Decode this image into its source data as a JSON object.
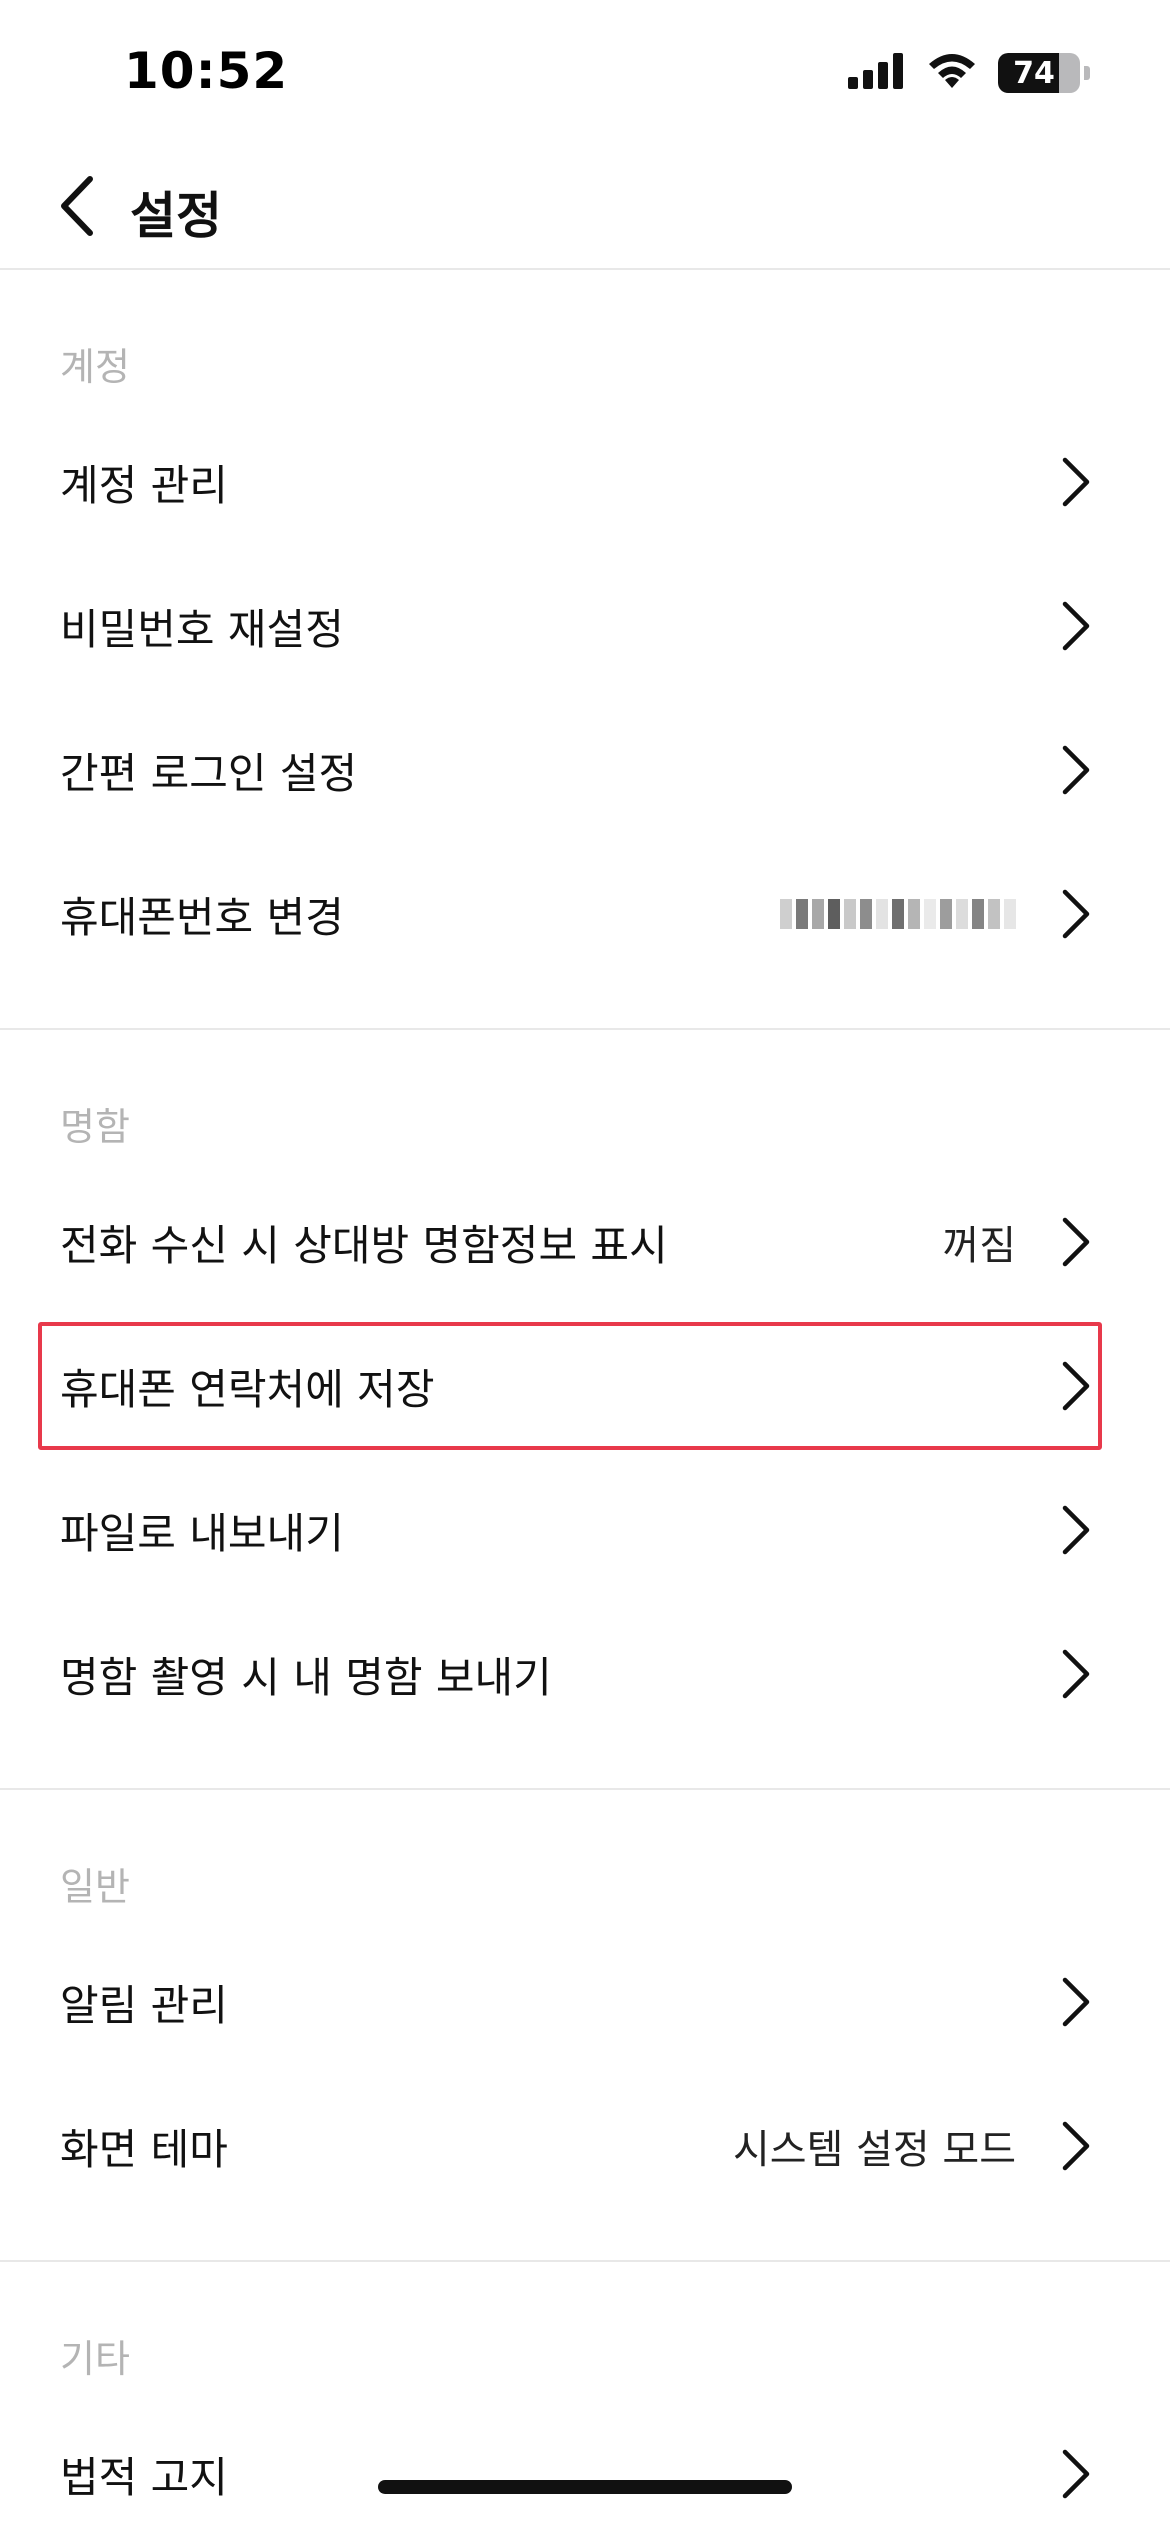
{
  "status_bar": {
    "time": "10:52",
    "battery_level": "74",
    "battery_fraction": 0.74,
    "icons": [
      "cellular-signal-icon",
      "wifi-icon",
      "battery-icon"
    ]
  },
  "header": {
    "title": "설정",
    "back_icon": "chevron-left-icon"
  },
  "sections": {
    "account": {
      "title": "계정",
      "items": [
        {
          "label": "계정 관리"
        },
        {
          "label": "비밀번호 재설정"
        },
        {
          "label": "간편 로그인 설정"
        },
        {
          "label": "휴대폰번호 변경"
        }
      ]
    },
    "card": {
      "title": "명함",
      "items": [
        {
          "label": "전화 수신 시 상대방 명함정보 표시",
          "value": "꺼짐"
        },
        {
          "label": "휴대폰 연락처에 저장",
          "highlighted": true
        },
        {
          "label": "파일로 내보내기"
        },
        {
          "label": "명함 촬영 시 내 명함 보내기"
        }
      ]
    },
    "general": {
      "title": "일반",
      "items": [
        {
          "label": "알림 관리"
        },
        {
          "label": "화면 테마",
          "value": "시스템 설정 모드"
        }
      ]
    },
    "other": {
      "title": "기타",
      "items": [
        {
          "label": "법적 고지"
        }
      ]
    }
  },
  "colors": {
    "highlight_border": "#e8394b",
    "section_title": "#b4b4b4",
    "divider": "#e8e8e8"
  }
}
